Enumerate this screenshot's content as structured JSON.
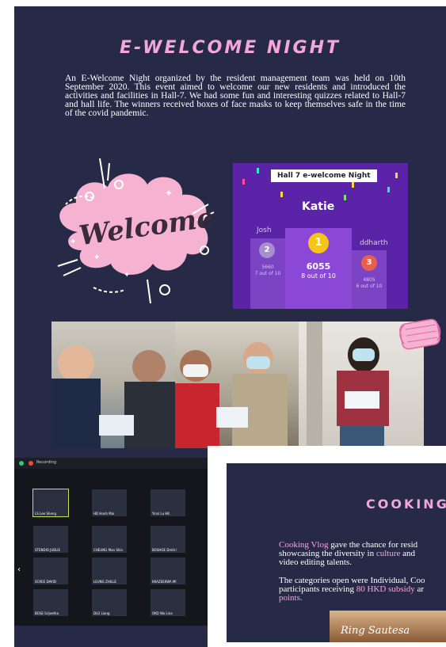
{
  "event": {
    "title": "E-WELCOME NIGHT",
    "intro": "An E-Welcome Night organized by the resident management team was held on 10th September 2020. This event aimed to welcome our new residents and introduced the activities and facilities in Hall-7. We had some fun and interesting quizzes related to Hall-7 and hall life. The winners received boxes of face masks to keep themselves safe in the time of the covid pandemic."
  },
  "welcome_art": {
    "text": "Welcome"
  },
  "kahoot": {
    "game_title": "Hall 7 e-welcome Night",
    "winner_name": "Katie",
    "first": {
      "rank": "1",
      "score": "6055",
      "correct": "8 out of 10"
    },
    "second": {
      "name": "Josh",
      "rank": "2",
      "score": "5660",
      "correct": "7 out of 10"
    },
    "third": {
      "name": "ddharth",
      "rank": "3",
      "score": "4805",
      "correct": "6 out of 10"
    }
  },
  "zoom": {
    "recording_label": "Recording",
    "participants": [
      "LS Lee Sheng",
      "HD Hanh Mai",
      "Yinsi Lu HK",
      "STENDIO JUBLIE",
      "CHEUNG Man Shin",
      "BOSHOE Dmitri",
      "SCREE DAVID",
      "LEUNG ZHILLE",
      "KKAZEEKWA MI",
      "BOSE Srijeetha",
      "DLO Liang",
      "OKO Wa Lina"
    ]
  },
  "cooking": {
    "title": "COOKING",
    "para1": [
      {
        "text": "Cooking Vlog",
        "pink": true
      },
      {
        "text": " gave the chance for resid",
        "pink": false
      }
    ],
    "para1_line2_a": "showcasing the diversity in ",
    "para1_line2_b": "culture",
    "para1_line2_c": " and",
    "para1_line3": "video editing talents.",
    "para2_line1": "The categories open were Individual, Coo",
    "para2_line2_a": "participants receiving ",
    "para2_line2_b": "80 HKD subsidy",
    "para2_line2_c": " ar",
    "para2_line3": "points.",
    "photo_caption": "Ring Sautesa"
  },
  "colors": {
    "background": "#262a47",
    "accent_pink": "#f4a6d8",
    "kahoot_purple": "#5b24a8",
    "gold": "#f5c518"
  }
}
